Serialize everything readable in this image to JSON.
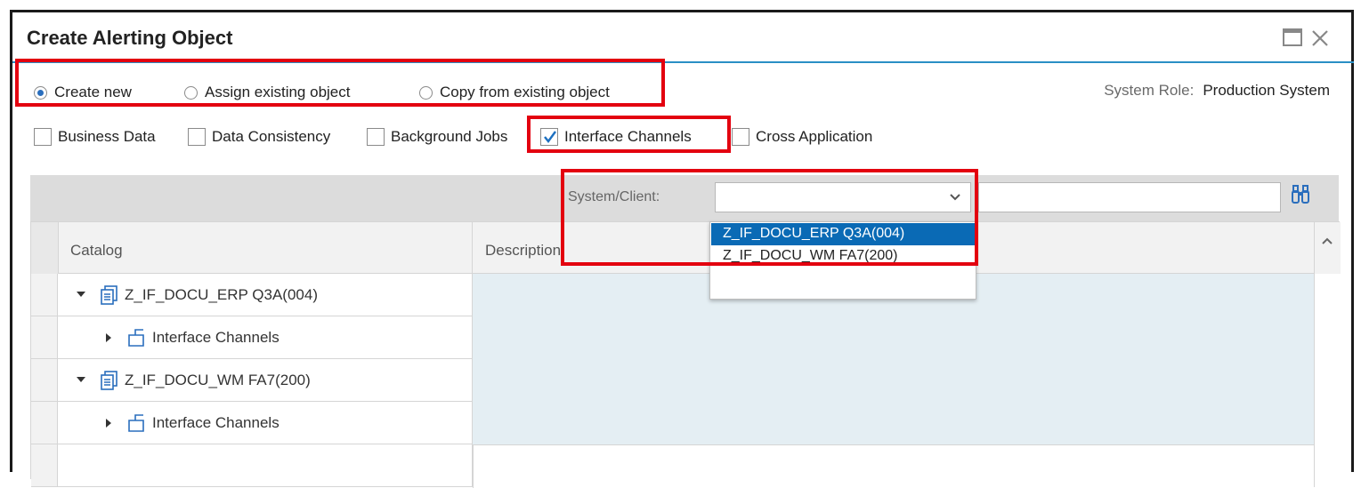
{
  "dialog": {
    "title": "Create Alerting Object"
  },
  "creation_mode": {
    "options": [
      {
        "label": "Create new",
        "selected": true
      },
      {
        "label": "Assign existing object",
        "selected": false
      },
      {
        "label": "Copy from existing object",
        "selected": false
      }
    ]
  },
  "system_role": {
    "label": "System Role:",
    "value": "Production System"
  },
  "categories": [
    {
      "label": "Business Data",
      "checked": false
    },
    {
      "label": "Data Consistency",
      "checked": false
    },
    {
      "label": "Background Jobs",
      "checked": false
    },
    {
      "label": "Interface Channels",
      "checked": true
    },
    {
      "label": "Cross Application",
      "checked": false
    }
  ],
  "filter": {
    "system_client_label": "System/Client:",
    "system_client_value": "",
    "search_value": "",
    "options": [
      {
        "label": "Z_IF_DOCU_ERP Q3A(004)",
        "highlighted": true
      },
      {
        "label": "Z_IF_DOCU_WM FA7(200)",
        "highlighted": false
      }
    ]
  },
  "table": {
    "columns": [
      "Catalog",
      "Description"
    ],
    "rows": [
      {
        "level": 0,
        "label": "Z_IF_DOCU_ERP Q3A(004)",
        "expanded": true,
        "icon": "catalog-icon"
      },
      {
        "level": 1,
        "label": "Interface Channels",
        "expanded": false,
        "icon": "folder-icon"
      },
      {
        "level": 0,
        "label": "Z_IF_DOCU_WM FA7(200)",
        "expanded": true,
        "icon": "catalog-icon"
      },
      {
        "level": 1,
        "label": "Interface Channels",
        "expanded": false,
        "icon": "folder-icon"
      }
    ]
  },
  "colors": {
    "accent": "#2a8fc5",
    "selection": "#0a6ab5",
    "highlight_box": "#e3000f",
    "description_fill": "#e4eef3"
  }
}
